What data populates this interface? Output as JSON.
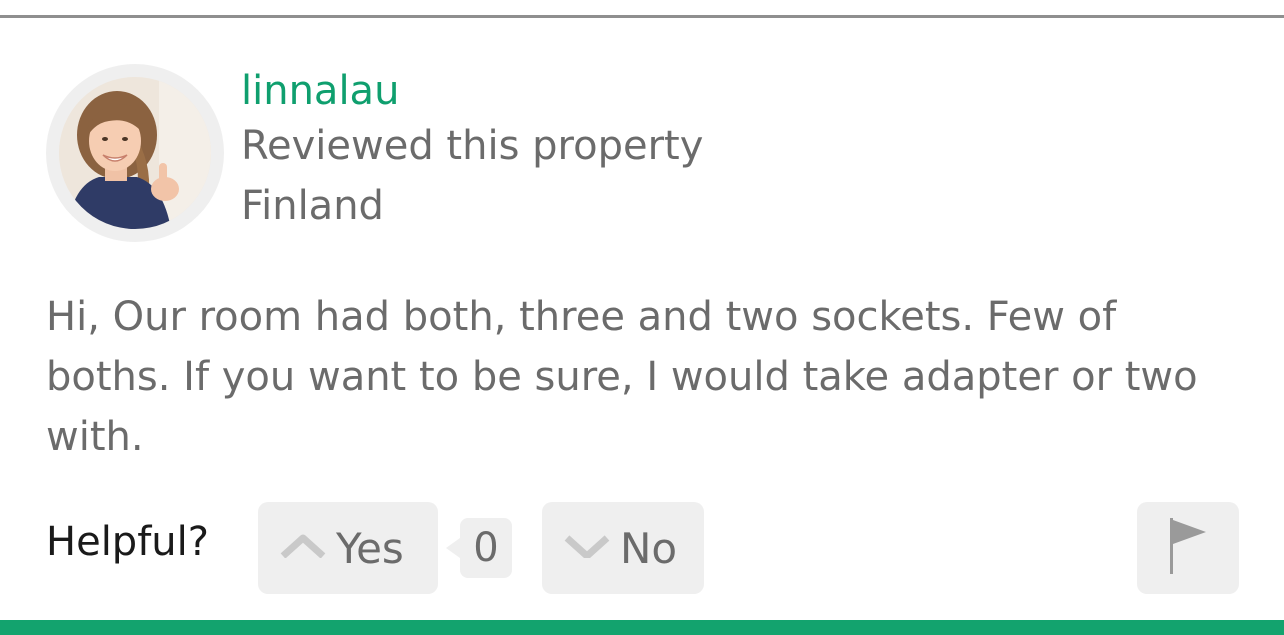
{
  "review": {
    "username": "linnalau",
    "action_text": "Reviewed this property",
    "location": "Finland",
    "text": "Hi, Our room had both, three and two sockets. Few of boths. If you want to be sure, I would take adapter or two with."
  },
  "helpful": {
    "label": "Helpful?",
    "yes_label": "Yes",
    "yes_count": "0",
    "no_label": "No"
  },
  "icons": {
    "yes": "chevron-up-icon",
    "no": "chevron-down-icon",
    "flag": "flag-icon"
  },
  "colors": {
    "accent": "#0f9f6e",
    "bottom_bar": "#13a36e",
    "text_muted": "#6b6b6b",
    "button_bg": "#efefef"
  }
}
